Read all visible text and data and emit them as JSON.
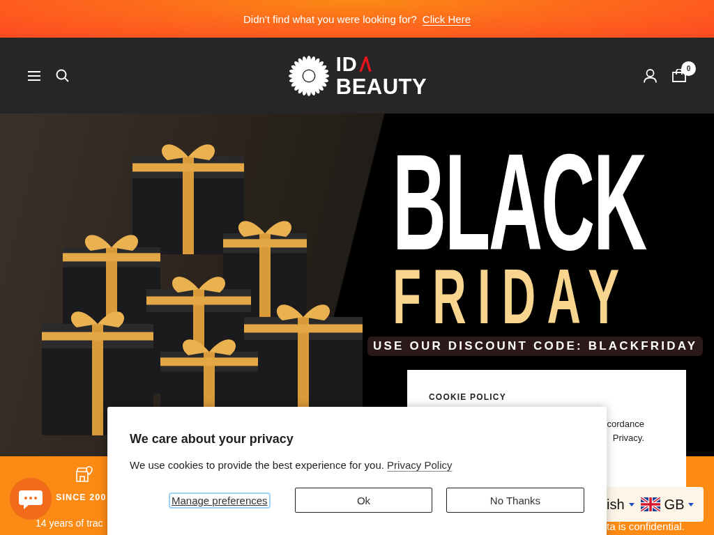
{
  "announcement": {
    "text": "Didn't find what you were looking for?",
    "link": "Click Here"
  },
  "header": {
    "logo": {
      "line_1": "ID",
      "line_2": "BEAUTY"
    },
    "cart_count": "0"
  },
  "hero": {
    "title": "BLACK",
    "subtitle": "FRIDAY",
    "code_banner": "USE OUR DISCOUNT CODE: BLACKFRIDAY"
  },
  "features": [
    {
      "title": "SINCE 200",
      "text": "14 years of trac"
    }
  ],
  "features_trailing_text": "ta is confidential.",
  "cookie_policy_card": {
    "title": "COOKIE POLICY",
    "lines": [
      "cordance",
      "Privacy."
    ]
  },
  "privacy_popup": {
    "title": "We care about your privacy",
    "text": "We use cookies to provide the best experience for you.",
    "link": "Privacy Policy",
    "buttons": [
      {
        "label": "Manage preferences",
        "kind": "link",
        "focused": true
      },
      {
        "label": "Ok",
        "kind": "outline",
        "focused": false
      },
      {
        "label": "No Thanks",
        "kind": "outline",
        "focused": false
      }
    ]
  },
  "language_selector": {
    "language": "ish",
    "country": "GB"
  }
}
